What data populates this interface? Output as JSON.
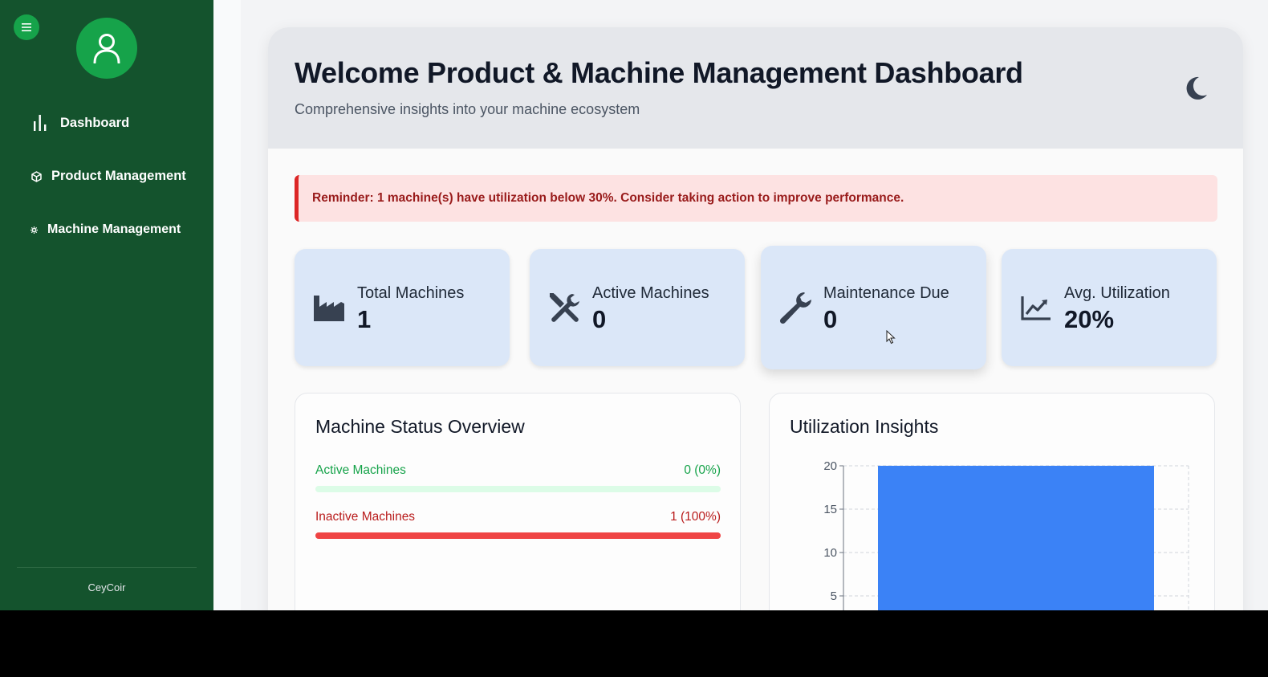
{
  "sidebar": {
    "menu_icon": "hamburger-icon",
    "avatar_icon": "user-icon",
    "items": [
      {
        "label": "Dashboard",
        "icon": "bar-chart-icon"
      },
      {
        "label": "Product Management",
        "icon": "cube-icon"
      },
      {
        "label": "Machine Management",
        "icon": "gear-icon"
      }
    ],
    "brand": "CeyCoir"
  },
  "header": {
    "title": "Welcome Product & Machine Management Dashboard",
    "subtitle": "Comprehensive insights into your machine ecosystem",
    "theme_icon": "moon-icon"
  },
  "reminder": {
    "text": "Reminder: 1 machine(s) have utilization below 30%. Consider taking action to improve performance."
  },
  "stats": [
    {
      "label": "Total Machines",
      "value": "1",
      "icon": "factory-icon"
    },
    {
      "label": "Active Machines",
      "value": "0",
      "icon": "tools-icon"
    },
    {
      "label": "Maintenance Due",
      "value": "0",
      "icon": "wrench-icon"
    },
    {
      "label": "Avg. Utilization",
      "value": "20%",
      "icon": "chart-line-icon"
    }
  ],
  "status_overview": {
    "title": "Machine Status Overview",
    "active": {
      "label": "Active Machines",
      "value": "0 (0%)",
      "fraction": 0.0
    },
    "inactive": {
      "label": "Inactive Machines",
      "value": "1 (100%)",
      "fraction": 1.0
    }
  },
  "utilization": {
    "title": "Utilization Insights"
  },
  "chart_data": {
    "type": "bar",
    "categories": [
      ""
    ],
    "values": [
      20
    ],
    "title": "Utilization Insights",
    "xlabel": "",
    "ylabel": "",
    "ylim": [
      0,
      20
    ],
    "yticks": [
      5,
      10,
      15,
      20
    ],
    "grid": true,
    "bar_color": "#3b82f6"
  },
  "colors": {
    "sidebar": "#14532d",
    "accent_green": "#16a34a",
    "danger": "#dc2626",
    "card_blue": "#dbe7f8"
  }
}
